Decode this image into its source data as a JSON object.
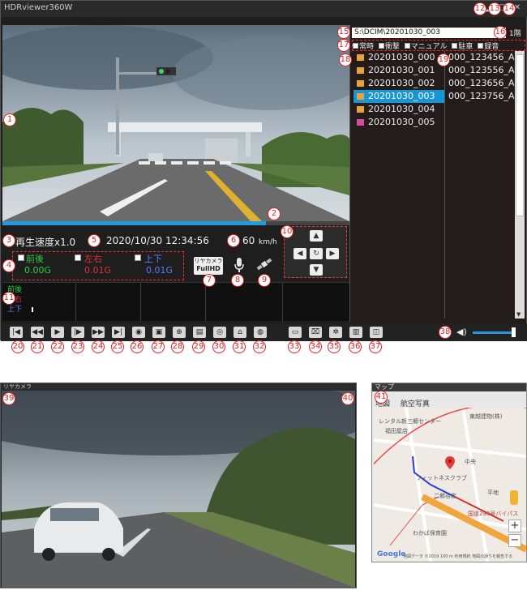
{
  "app": {
    "title": "HDRviewer360W"
  },
  "path": {
    "value": "S:\\DCIM\\20201030_003",
    "button": "1階"
  },
  "filters": [
    "常時",
    "衝撃",
    "マニュアル",
    "駐車",
    "録音"
  ],
  "folders": [
    {
      "name": "20201030_000",
      "color": "#e8a33a"
    },
    {
      "name": "20201030_001",
      "color": "#e8a33a"
    },
    {
      "name": "20201030_002",
      "color": "#e8a33a"
    },
    {
      "name": "20201030_003",
      "color": "#e8a33a",
      "selected": true
    },
    {
      "name": "20201030_004",
      "color": "#e8a33a"
    },
    {
      "name": "20201030_005",
      "color": "#d24fa0"
    }
  ],
  "files": [
    "000_123456_A",
    "000_123556_A",
    "000_123656_A",
    "000_123756_A"
  ],
  "playback": {
    "speed_label": "再生速度x1.0",
    "datetime": "2020/10/30 12:34:56",
    "speed_value": "60",
    "speed_unit": "km/h",
    "progress": 0.76
  },
  "gsensor": {
    "front_back_label": "前後",
    "left_right_label": "左右",
    "up_down_label": "上下",
    "front_back_value": "0.00G",
    "left_right_value": "0.01G",
    "up_down_value": "0.01G",
    "front_back_color": "#2ecc40",
    "left_right_color": "#e23030",
    "up_down_color": "#5a7bff"
  },
  "camera_badge": {
    "line1": "リヤカメラ",
    "line2": "FullHD"
  },
  "graph_labels": [
    "前後",
    "左右",
    "上下"
  ],
  "rear": {
    "title": "リヤカメラ"
  },
  "map": {
    "title": "マップ",
    "tab_map": "地図",
    "tab_satellite": "航空写真",
    "places": [
      "レンタル新三郷センター",
      "東越建物(株)",
      "福田屋店",
      "フィットネスクラブ",
      "二郷谷店",
      "中央",
      "平地",
      "わかば保育園"
    ],
    "road": "国道298号バイパス",
    "zoom_in": "+",
    "zoom_out": "−",
    "footer": "地図データ ©2019  100 m  利用規約  地図の誤りを報告する",
    "google": "Google"
  },
  "numbers": [
    "1",
    "2",
    "3",
    "4",
    "5",
    "6",
    "7",
    "8",
    "9",
    "10",
    "11",
    "12",
    "13",
    "14",
    "15",
    "16",
    "17",
    "18",
    "19",
    "20",
    "21",
    "22",
    "23",
    "24",
    "25",
    "26",
    "27",
    "28",
    "29",
    "30",
    "31",
    "32",
    "33",
    "34",
    "35",
    "36",
    "37",
    "38",
    "39",
    "40",
    "41"
  ],
  "icons": {
    "toolbar": [
      "skip-start-icon",
      "rewind-icon",
      "play-icon",
      "step-frame-icon",
      "fast-forward-icon",
      "skip-end-icon",
      "snapshot-icon",
      "video-clip-icon",
      "zoom-icon",
      "image-adjust-icon",
      "panorama-icon",
      "lock-icon",
      "globe-icon",
      "folder-icon",
      "trash-icon",
      "settings-icon",
      "rear-view-icon",
      "window-icon"
    ]
  }
}
